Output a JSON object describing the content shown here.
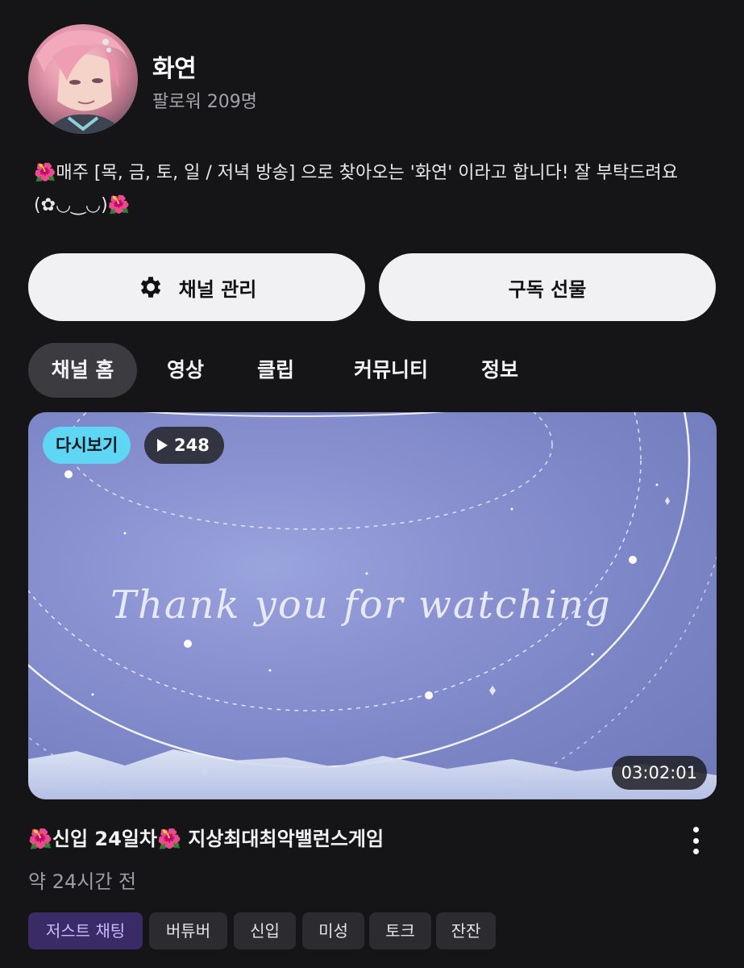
{
  "profile": {
    "name": "화연",
    "followers": "팔로워 209명",
    "bio": "🌺매주 [목, 금, 토, 일 / 저녁 방송] 으로 찾아오는 '화연' 이라고 합니다! 잘 부탁드려요 (✿◡‿◡)🌺"
  },
  "actions": {
    "manage_label": "채널 관리",
    "gift_label": "구독 선물"
  },
  "tabs": [
    {
      "label": "채널 홈",
      "active": true
    },
    {
      "label": "영상",
      "active": false
    },
    {
      "label": "클립",
      "active": false
    },
    {
      "label": "커뮤니티",
      "active": false
    },
    {
      "label": "정보",
      "active": false
    }
  ],
  "video": {
    "badge": "다시보기",
    "views": "248",
    "thumbnail_text": "Thank you for watching",
    "duration": "03:02:01",
    "title": "🌺신입 24일차🌺 지상최대최악밸런스게임",
    "time": "약 24시간 전",
    "tags": [
      "저스트 채팅",
      "버튜버",
      "신입",
      "미성",
      "토크",
      "잔잔"
    ]
  },
  "colors": {
    "background": "#151518",
    "button_bg": "#f1f1f3",
    "active_tab": "#3b3b40",
    "replay_badge": "#5fd6f4",
    "category_tag_bg": "#3a2b66",
    "category_tag_text": "#c9b8ff"
  },
  "icons": [
    "gear-icon",
    "play-icon",
    "more-vertical-icon"
  ]
}
